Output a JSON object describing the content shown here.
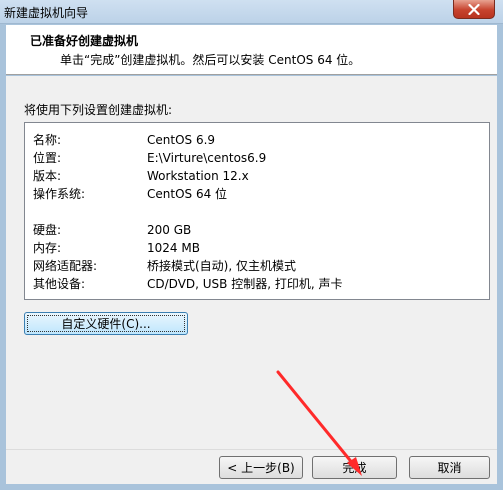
{
  "window": {
    "title": "新建虚拟机向导"
  },
  "header": {
    "title": "已准备好创建虚拟机",
    "subtitle": "单击“完成”创建虚拟机。然后可以安装 CentOS 64 位。"
  },
  "content": {
    "intro": "将使用下列设置创建虚拟机:",
    "settings": [
      {
        "label": "名称:",
        "value": "CentOS 6.9"
      },
      {
        "label": "位置:",
        "value": "E:\\Virture\\centos6.9"
      },
      {
        "label": "版本:",
        "value": "Workstation 12.x"
      },
      {
        "label": "操作系统:",
        "value": "CentOS 64 位"
      },
      {
        "label": "硬盘:",
        "value": "200 GB"
      },
      {
        "label": "内存:",
        "value": "1024 MB"
      },
      {
        "label": "网络适配器:",
        "value": "桥接模式(自动), 仅主机模式"
      },
      {
        "label": "其他设备:",
        "value": "CD/DVD, USB 控制器, 打印机, 声卡"
      }
    ],
    "customize_label": "自定义硬件(C)..."
  },
  "footer": {
    "back_label": "< 上一步(B)",
    "finish_label": "完成",
    "cancel_label": "取消"
  },
  "colors": {
    "annotation_arrow": "#ff2a2a",
    "close_button": "#c7432e"
  },
  "icons": [
    "close-icon"
  ]
}
